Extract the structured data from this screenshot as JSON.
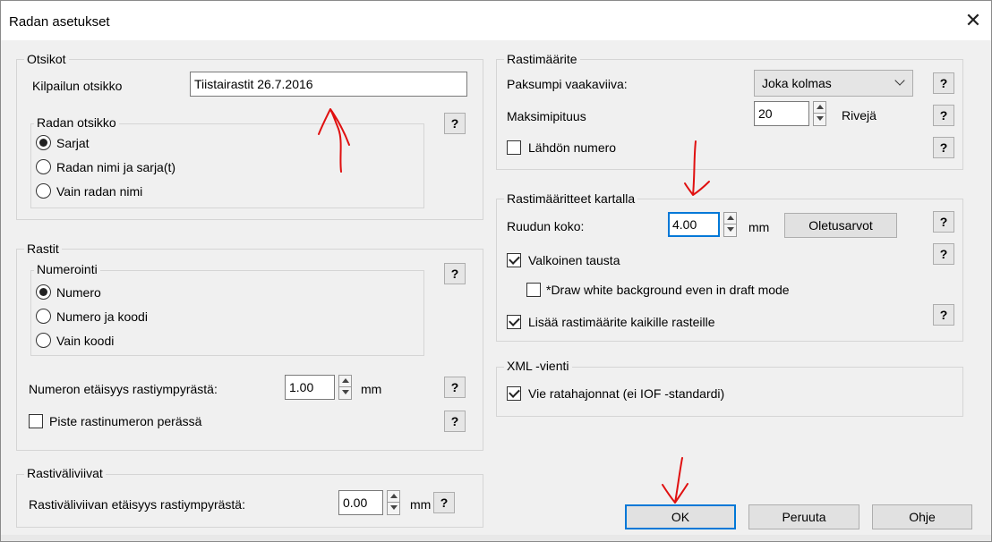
{
  "window": {
    "title": "Radan asetukset",
    "close_symbol": "✕"
  },
  "otsikot": {
    "group_label": "Otsikot",
    "kilpailun_label": "Kilpailun otsikko",
    "kilpailun_value": "Tiistairastit 26.7.2016",
    "radan_otsikko_label": "Radan otsikko",
    "radio_options": [
      "Sarjat",
      "Radan nimi ja sarja(t)",
      "Vain radan nimi"
    ],
    "selected": "Sarjat"
  },
  "rastit": {
    "group_label": "Rastit",
    "numerointi_label": "Numerointi",
    "radio_options": [
      "Numero",
      "Numero ja koodi",
      "Vain koodi"
    ],
    "selected": "Numero",
    "distance_label": "Numeron etäisyys rastiympyrästä:",
    "distance_value": "1.00",
    "distance_unit": "mm",
    "piste_label": "Piste rastinumeron perässä",
    "piste_checked": false
  },
  "rastivaliviivat": {
    "group_label": "Rastiväliviivat",
    "distance_label": "Rastiväliviivan etäisyys rastiympyrästä:",
    "distance_value": "0.00",
    "distance_unit": "mm"
  },
  "rastimaarite": {
    "group_label": "Rastimäärite",
    "paksumpi_label": "Paksumpi vaakaviiva:",
    "paksumpi_value": "Joka kolmas",
    "maksimi_label": "Maksimipituus",
    "maksimi_value": "20",
    "maksimi_unit": "Rivejä",
    "lahdon_label": "Lähdön numero",
    "lahdon_checked": false
  },
  "kartalla": {
    "group_label": "Rastimääritteet kartalla",
    "ruudun_label": "Ruudun koko:",
    "ruudun_value": "4.00",
    "ruudun_unit": "mm",
    "oletusarvot_label": "Oletusarvot",
    "valkoinen_label": "Valkoinen tausta",
    "valkoinen_checked": true,
    "draft_label": "*Draw white background even in draft mode",
    "draft_checked": false,
    "lisaa_label": "Lisää rastimäärite kaikille rasteille",
    "lisaa_checked": true
  },
  "xml": {
    "group_label": "XML -vienti",
    "vie_label": "Vie ratahajonnat (ei IOF -standardi)",
    "vie_checked": true
  },
  "help_symbol": "?",
  "buttons": {
    "ok": "OK",
    "cancel": "Peruuta",
    "help": "Ohje"
  },
  "colors": {
    "focus_blue": "#0078d7",
    "annotation_red": "#e01010"
  }
}
